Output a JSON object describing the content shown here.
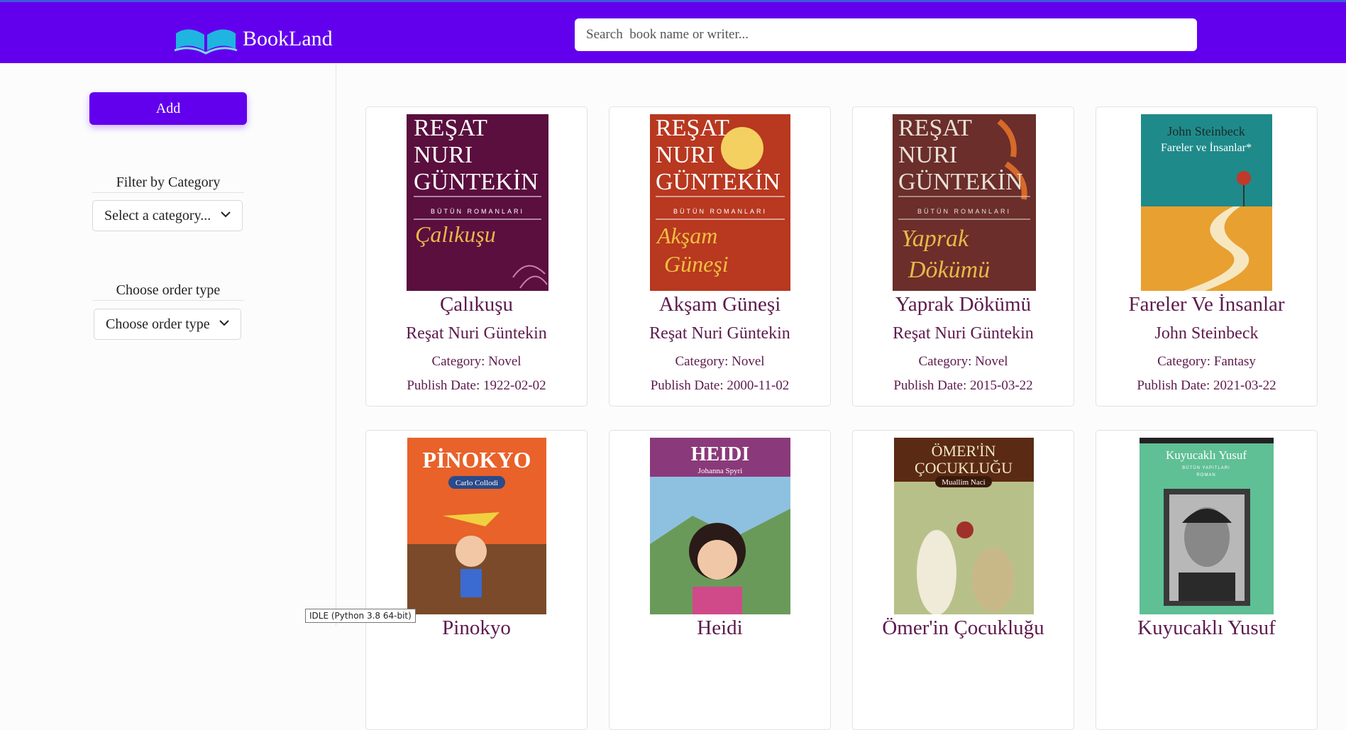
{
  "header": {
    "brand": "BookLand",
    "search_placeholder": "Search  book name or writer..."
  },
  "sidebar": {
    "add_label": "Add",
    "filter_label": "Filter by Category",
    "filter_value": "Select a category...",
    "order_label": "Choose order type",
    "order_value": "Choose order type"
  },
  "books": [
    {
      "title": "Çalıkuşu",
      "author": "Reşat Nuri Güntekin",
      "category": "Category: Novel",
      "date": "Publish Date: 1922-02-02",
      "cover": {
        "bg": "#5a0f3e",
        "l1": "REŞAT",
        "l2": "NURI",
        "l3": "GÜNTEKİN",
        "sub": "BÜTÜN ROMANLARI",
        "name": "Çalıkuşu",
        "accent": "#e8b84a"
      }
    },
    {
      "title": "Akşam Güneşi",
      "author": "Reşat Nuri Güntekin",
      "category": "Category: Novel",
      "date": "Publish Date: 2000-11-02",
      "cover": {
        "bg": "#b83820",
        "l1": "REŞAT",
        "l2": "NURI",
        "l3": "GÜNTEKİN",
        "sub": "BÜTÜN ROMANLARI",
        "name": "Akşam Güneşi",
        "accent": "#f0c040"
      }
    },
    {
      "title": "Yaprak Dökümü",
      "author": "Reşat Nuri Güntekin",
      "category": "Category: Novel",
      "date": "Publish Date: 2015-03-22",
      "cover": {
        "bg": "#6b2e2a",
        "l1": "REŞAT",
        "l2": "NURI",
        "l3": "GÜNTEKİN",
        "sub": "BÜTÜN ROMANLARI",
        "name": "Yaprak Dökümü",
        "accent": "#e8b84a"
      }
    },
    {
      "title": "Fareler Ve İnsanlar",
      "author": "John Steinbeck",
      "category": "Category: Fantasy",
      "date": "Publish Date: 2021-03-22",
      "cover": {
        "bg": "#1f8a8a",
        "l1": "John Steinbeck",
        "l2": "Fareler ve İnsanlar*",
        "name": "",
        "accent": "#e8a030"
      }
    },
    {
      "title": "Pinokyo",
      "cover": {
        "bg": "#e8622a",
        "l1": "PİNOKYO",
        "l2": "Carlo Collodi"
      }
    },
    {
      "title": "Heidi",
      "cover": {
        "bg": "#8a3a7a",
        "l1": "HEIDI",
        "l2": "Johanna Spyri"
      }
    },
    {
      "title": "Ömer'in Çocukluğu",
      "cover": {
        "bg": "#5a2a14",
        "l1": "ÖMER'İN",
        "l2": "ÇOCUKLUĞU",
        "l3": "Muallim Naci"
      }
    },
    {
      "title": "Kuyucaklı Yusuf",
      "cover": {
        "bg": "#5fbf95",
        "l1": "Kuyucaklı Yusuf",
        "l2": "BÜTÜN YAPITLARI",
        "l3": "ROMAN"
      }
    }
  ],
  "tooltip": "IDLE (Python 3.8 64-bit)"
}
